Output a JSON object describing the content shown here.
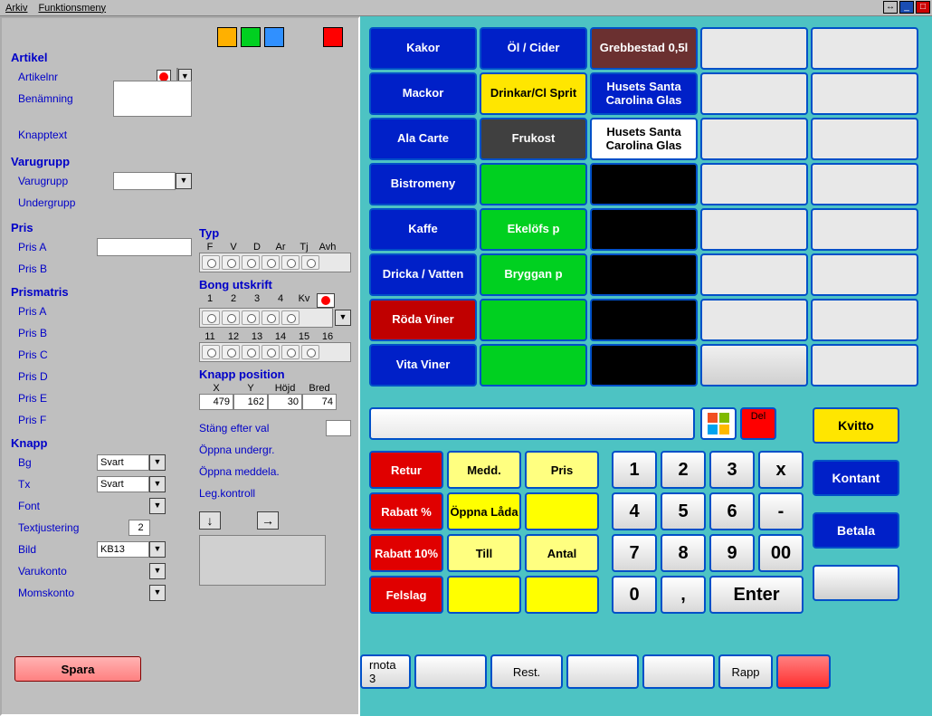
{
  "menu": {
    "arkiv": "Arkiv",
    "funktionsmeny": "Funktionsmeny"
  },
  "sidebar": {
    "artikel": {
      "hdr": "Artikel",
      "artikelnr": "Artikelnr",
      "benamning": "Benämning",
      "knapptext": "Knapptext"
    },
    "varugrupp": {
      "hdr": "Varugrupp",
      "varugrupp": "Varugrupp",
      "undergrupp": "Undergrupp"
    },
    "pris": {
      "hdr": "Pris",
      "a": "Pris A",
      "b": "Pris B"
    },
    "prismatris": {
      "hdr": "Prismatris",
      "a": "Pris A",
      "b": "Pris B",
      "c": "Pris C",
      "d": "Pris D",
      "e": "Pris E",
      "f": "Pris F"
    },
    "knapp": {
      "hdr": "Knapp",
      "bg": "Bg",
      "tx": "Tx",
      "font": "Font",
      "textjustering": "Textjustering",
      "bild": "Bild",
      "varukonto": "Varukonto",
      "momskonto": "Momskonto",
      "bg_val": "Svart",
      "tx_val": "Svart",
      "text_just_val": "2",
      "bild_val": "KB13"
    },
    "typ": {
      "hdr": "Typ",
      "cols": [
        "F",
        "V",
        "D",
        "Ar",
        "Tj",
        "Avh"
      ]
    },
    "bong": {
      "hdr": "Bong utskrift",
      "row1": [
        "1",
        "2",
        "3",
        "4",
        "Kv"
      ],
      "row2": [
        "11",
        "12",
        "13",
        "14",
        "15",
        "16"
      ]
    },
    "knapp_pos": {
      "hdr": "Knapp position",
      "labels": [
        "X",
        "Y",
        "Höjd",
        "Bred"
      ],
      "vals": [
        "479",
        "162",
        "30",
        "74"
      ]
    },
    "links": {
      "stang": "Stäng efter val",
      "oppna_u": "Öppna undergr.",
      "oppna_m": "Öppna meddela.",
      "leg": "Leg.kontroll"
    },
    "spara": "Spara"
  },
  "pos_grid": [
    [
      "Kakor",
      "blue"
    ],
    [
      "Öl / Cider",
      "blue"
    ],
    [
      "Grebbestad 0,5l",
      "brown"
    ],
    [
      "",
      ""
    ],
    [
      "",
      ""
    ],
    [
      "Mackor",
      "blue"
    ],
    [
      "Drinkar/Cl Sprit",
      "yellow"
    ],
    [
      "Husets Santa Carolina Glas",
      "darkblue"
    ],
    [
      "",
      ""
    ],
    [
      "",
      ""
    ],
    [
      "Ala Carte",
      "blue"
    ],
    [
      "Frukost",
      "gray"
    ],
    [
      "Husets Santa Carolina Glas",
      "white"
    ],
    [
      "",
      ""
    ],
    [
      "",
      ""
    ],
    [
      "Bistromeny",
      "blue"
    ],
    [
      "",
      "green"
    ],
    [
      "",
      "black"
    ],
    [
      "",
      ""
    ],
    [
      "",
      ""
    ],
    [
      "Kaffe",
      "blue"
    ],
    [
      "Ekelöfs p",
      "green"
    ],
    [
      "",
      "black"
    ],
    [
      "",
      ""
    ],
    [
      "",
      ""
    ],
    [
      "Dricka / Vatten",
      "blue"
    ],
    [
      "Bryggan p",
      "green"
    ],
    [
      "",
      "black"
    ],
    [
      "",
      ""
    ],
    [
      "",
      ""
    ],
    [
      "Röda Viner",
      "red"
    ],
    [
      "",
      "green"
    ],
    [
      "",
      "black"
    ],
    [
      "",
      ""
    ],
    [
      "",
      ""
    ],
    [
      "Vita Viner",
      "blue"
    ],
    [
      "",
      "green"
    ],
    [
      "",
      "black"
    ],
    [
      "",
      "lgray"
    ],
    [
      "",
      ""
    ]
  ],
  "del": "Del",
  "right": {
    "kvitto": "Kvitto",
    "kontant": "Kontant",
    "betala": "Betala"
  },
  "func": [
    [
      "Retur",
      "red"
    ],
    [
      "Medd.",
      "lyellow"
    ],
    [
      "Pris",
      "lyellow"
    ],
    [
      "Rabatt %",
      "red"
    ],
    [
      "Öppna Låda",
      "yellow"
    ],
    [
      "",
      "yellow"
    ],
    [
      "Rabatt 10%",
      "red"
    ],
    [
      "Till",
      "lyellow"
    ],
    [
      "Antal",
      "lyellow"
    ],
    [
      "Felslag",
      "red"
    ],
    [
      "",
      "yellow"
    ],
    [
      "",
      "yellow"
    ]
  ],
  "numpad": [
    "1",
    "2",
    "3",
    "x",
    "4",
    "5",
    "6",
    "-",
    "7",
    "8",
    "9",
    "00",
    "0",
    ",",
    "Enter"
  ],
  "tabs": {
    "nota": "rnota 3",
    "rest": "Rest.",
    "rapp": "Rapp"
  }
}
